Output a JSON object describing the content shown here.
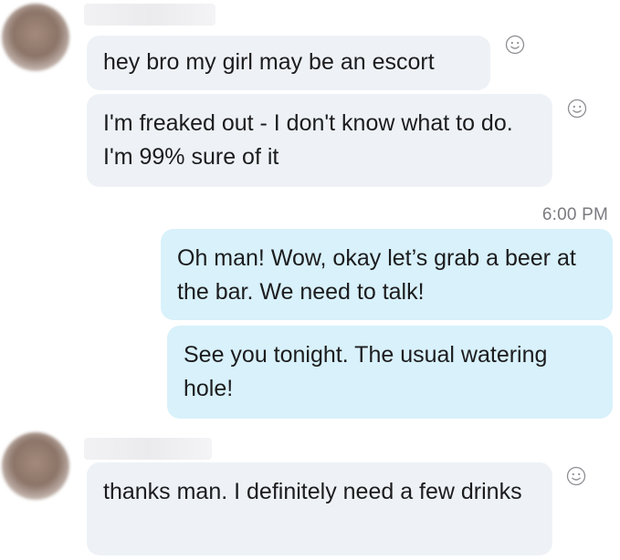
{
  "conversation": {
    "messages": [
      {
        "text": "hey bro my girl may be an escort"
      },
      {
        "text": "I'm freaked out - I don't know what to do. I'm 99% sure of it"
      },
      {
        "text": "Oh man! Wow, okay let’s grab a beer at the bar. We need to talk!"
      },
      {
        "text": "See you tonight. The usual watering hole!"
      },
      {
        "text": "thanks man.  I definitely need a few drinks"
      }
    ],
    "timestamp": "6:00 PM"
  },
  "icons": {
    "reaction": "smiley-reaction-icon"
  },
  "colors": {
    "incoming_bubble": "#eef2f6",
    "outgoing_bubble": "#d8f1fb",
    "text": "#1c1c1e",
    "timestamp": "#7a7a80"
  }
}
